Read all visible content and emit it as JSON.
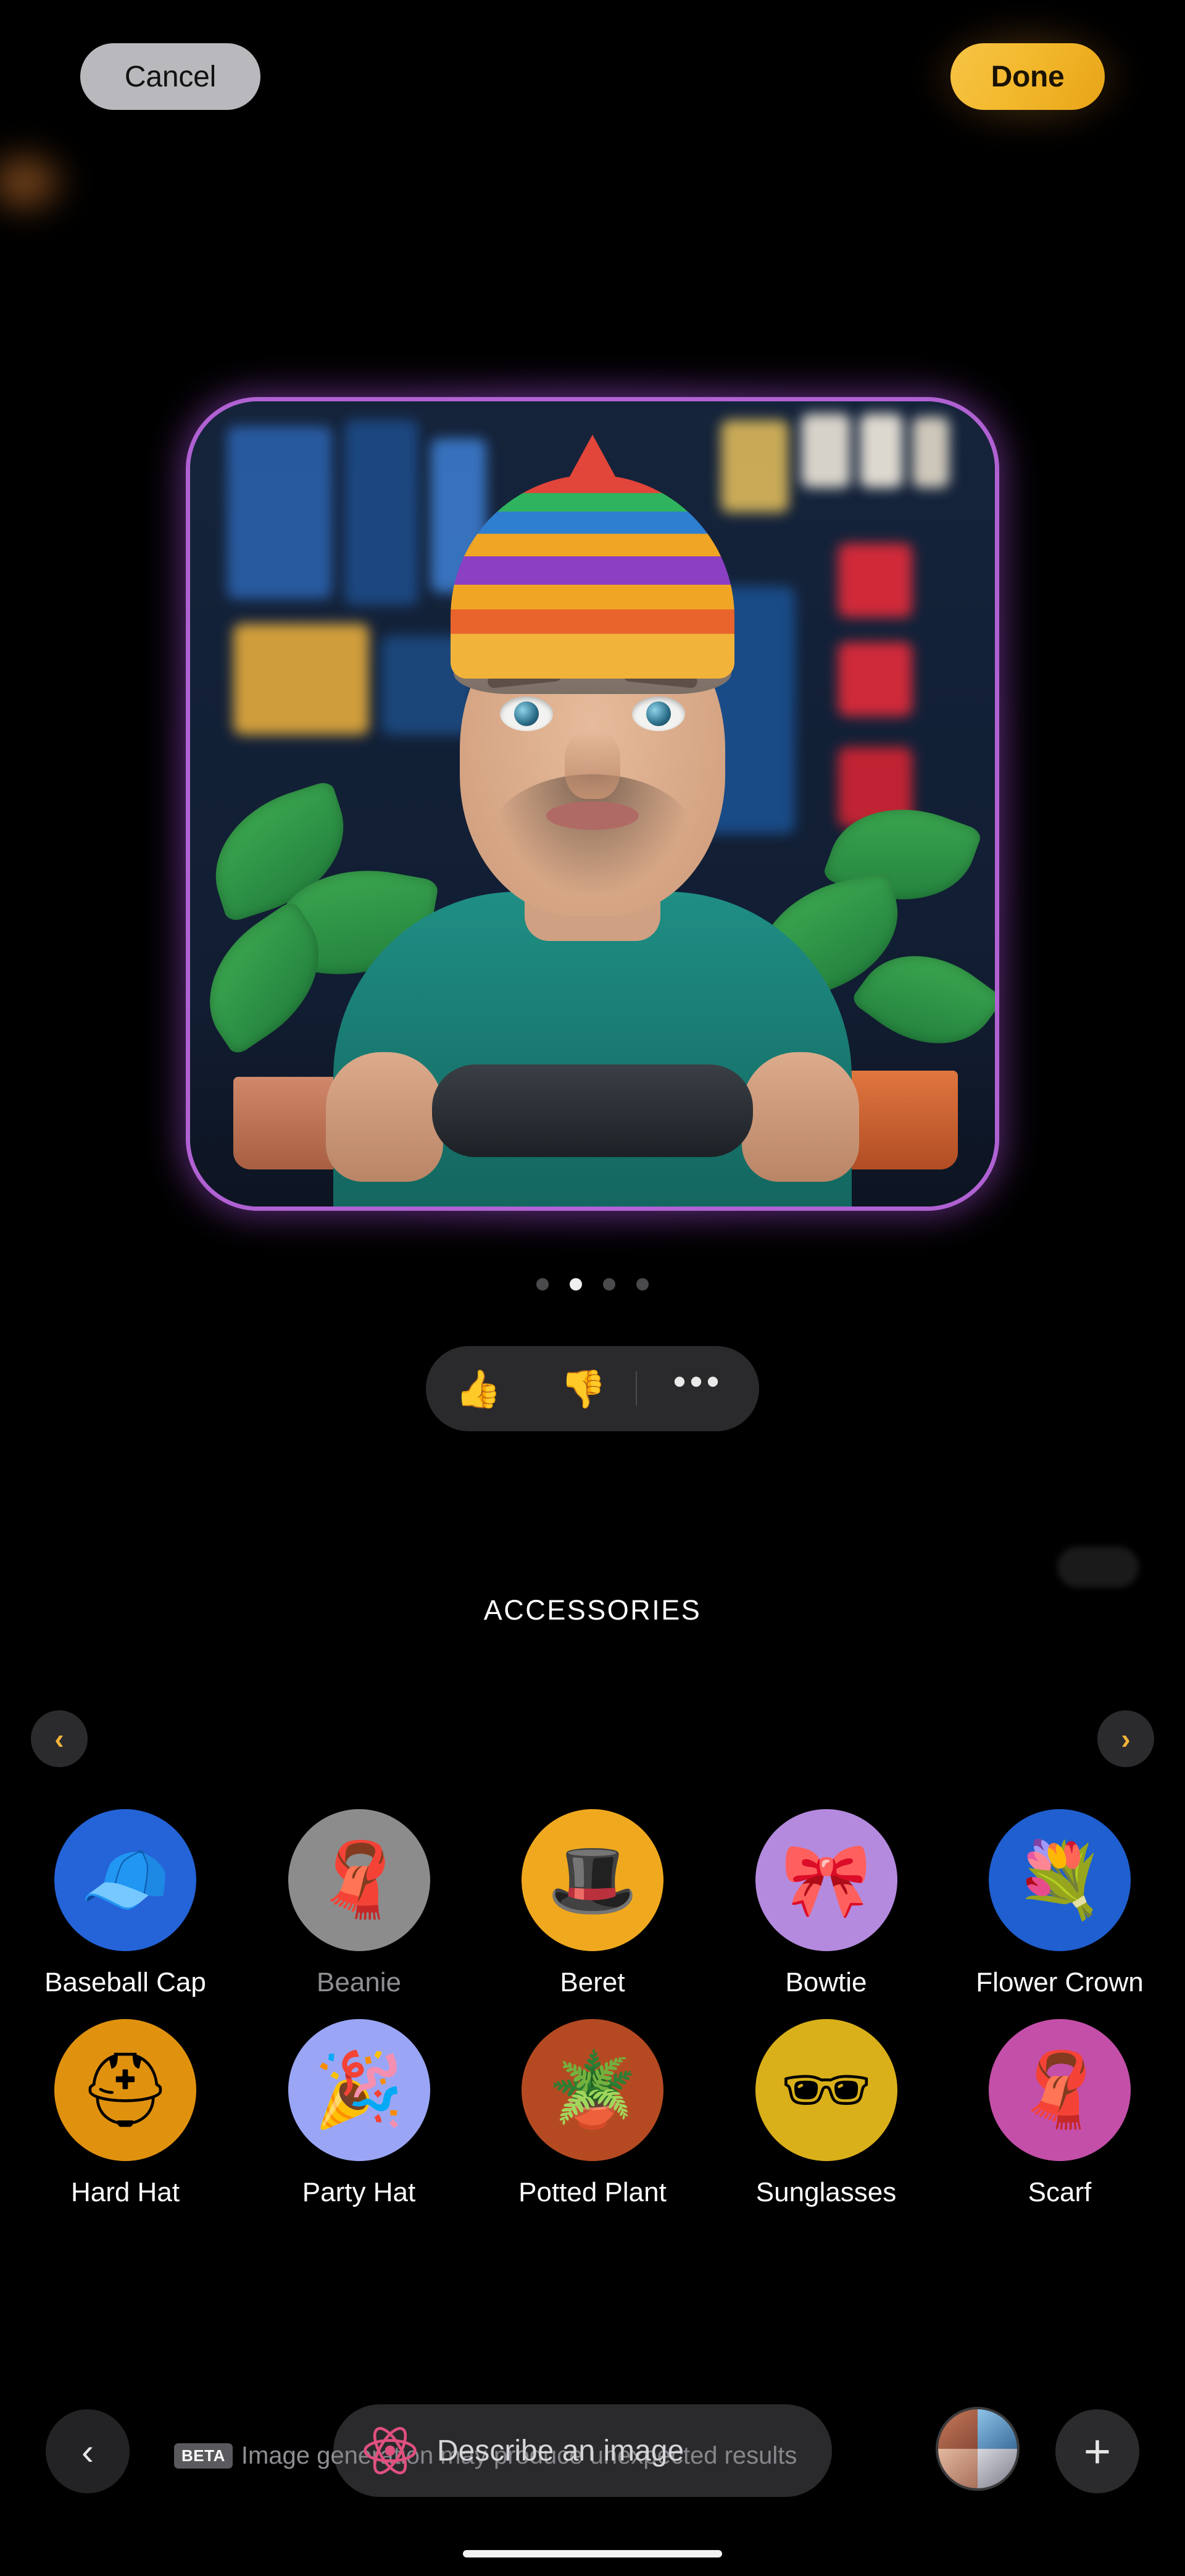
{
  "topbar": {
    "cancel_label": "Cancel",
    "done_label": "Done"
  },
  "carousel": {
    "dot_count": 4,
    "active_index": 1
  },
  "reactions": {
    "thumbs_up_icon": "👍",
    "thumbs_down_icon": "👎",
    "more_label": "•••"
  },
  "accessories": {
    "title": "ACCESSORIES",
    "prev_arrow": "‹",
    "next_arrow": "›",
    "rows": [
      [
        {
          "label": "Baseball Cap",
          "icon": "🧢",
          "bg": "#2563d8",
          "dim": false
        },
        {
          "label": "Beanie",
          "icon": "🧣",
          "bg": "#8c8c8c",
          "dim": true
        },
        {
          "label": "Beret",
          "icon": "🎩",
          "bg": "#f0a91e",
          "dim": false
        },
        {
          "label": "Bowtie",
          "icon": "🎀",
          "bg": "#b48adf",
          "dim": false
        },
        {
          "label": "Flower Crown",
          "icon": "💐",
          "bg": "#1f5fd0",
          "dim": false
        }
      ],
      [
        {
          "label": "Hard Hat",
          "icon": "⛑",
          "bg": "#e0920f",
          "dim": false
        },
        {
          "label": "Party Hat",
          "icon": "🎉",
          "bg": "#9aa6f5",
          "dim": false
        },
        {
          "label": "Potted Plant",
          "icon": "🪴",
          "bg": "#b54a22",
          "dim": false
        },
        {
          "label": "Sunglasses",
          "icon": "🕶",
          "bg": "#d9b01a",
          "dim": false
        },
        {
          "label": "Scarf",
          "icon": "🧣",
          "bg": "#c44fa8",
          "dim": false
        }
      ]
    ]
  },
  "bottom": {
    "back_arrow": "‹",
    "beta_tag": "BETA",
    "beta_text": "Image generation may produce unexpected results",
    "prompt_placeholder": "Describe an image",
    "plus_label": "+"
  },
  "colors": {
    "accent_yellow": "#f2b33a",
    "card_glow_purple": "#c56eeb",
    "background": "#000000"
  }
}
